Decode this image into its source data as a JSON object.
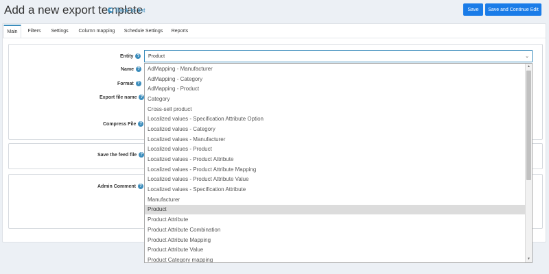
{
  "header": {
    "title": "Add a new export template",
    "back_label": "Back to list",
    "save_label": "Save",
    "save_continue_label": "Save and Continue Edit"
  },
  "tabs": [
    {
      "label": "Main",
      "active": true
    },
    {
      "label": "Filters"
    },
    {
      "label": "Settings"
    },
    {
      "label": "Column mapping"
    },
    {
      "label": "Schedule Settings"
    },
    {
      "label": "Reports"
    }
  ],
  "form": {
    "entity_label": "Entity",
    "name_label": "Name",
    "format_label": "Format",
    "export_file_name_label": "Export file name",
    "compress_file_label": "Compress File",
    "save_feed_file_label": "Save the feed file",
    "admin_comment_label": "Admin Comment",
    "entity_value": "Product"
  },
  "dropdown": {
    "options": [
      "AdMapping - Manufacturer",
      "AdMapping - Category",
      "AdMapping - Product",
      "Category",
      "Cross-sell product",
      "Localized values - Specification Attribute Option",
      "Localized values - Category",
      "Localized values - Manufacturer",
      "Localized values - Product",
      "Localized values - Product Attribute",
      "Localized values - Product Attribute Mapping",
      "Localized values - Product Attribute Value",
      "Localized values - Specification Attribute",
      "Manufacturer",
      "Product",
      "Product Attribute",
      "Product Attribute Combination",
      "Product Attribute Mapping",
      "Product Attribute Value",
      "Product Category mapping"
    ],
    "selected": "Product"
  },
  "colors": {
    "accent": "#3c8dbc",
    "button": "#1a7ce8"
  },
  "icons": {
    "back": "arrow-left-circle-icon",
    "help": "question-circle-icon",
    "caret": "chevron-down-icon"
  }
}
